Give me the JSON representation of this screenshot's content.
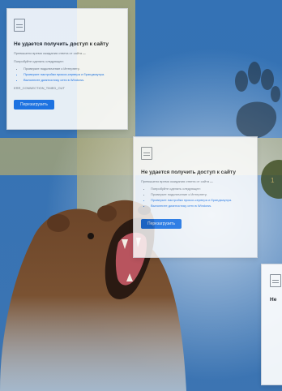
{
  "error_page_1": {
    "icon": "document-error-icon",
    "title": "Не удается получить доступ к сайту",
    "line1_prefix": "Превышено время ожидания ответа от сайта",
    "line1_host": "...",
    "line2": "Попробуйте сделать следующее:",
    "bullets": [
      "Проверьте подключение к Интернету.",
      "Проверьте настройки прокси-сервера и брандмауэра.",
      "Выполните диагностику сети в Windows."
    ],
    "footer": "ERR_CONNECTION_TIMED_OUT",
    "button": "Перезагрузить"
  },
  "error_page_2": {
    "icon": "document-error-icon",
    "title": "Не удается получить доступ к сайту",
    "line1_prefix": "Превышено время ожидания ответа от сайта",
    "line1_host": "...",
    "bullets": [
      "Попробуйте сделать следующее:",
      "Проверьте подключение к Интернету.",
      "Проверьте настройки прокси-сервера и брандмауэра.",
      "Выполните диагностику сети в Windows."
    ],
    "button": "Перезагрузить"
  },
  "error_page_3": {
    "icon": "document-error-icon",
    "title": "Не"
  }
}
